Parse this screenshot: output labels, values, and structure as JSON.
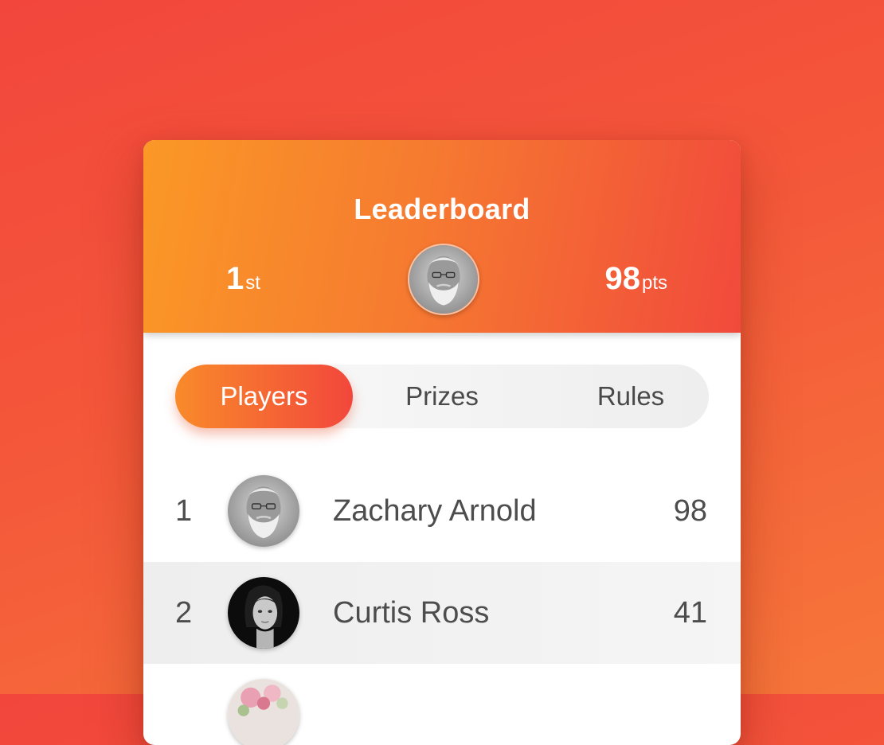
{
  "header": {
    "title": "Leaderboard",
    "rank_number": "1",
    "rank_suffix": "st",
    "points_number": "98",
    "points_suffix": "pts"
  },
  "tabs": [
    {
      "label": "Players",
      "active": true
    },
    {
      "label": "Prizes",
      "active": false
    },
    {
      "label": "Rules",
      "active": false
    }
  ],
  "players": [
    {
      "rank": "1",
      "name": "Zachary Arnold",
      "score": "98",
      "avatar": "elderly-man-avatar"
    },
    {
      "rank": "2",
      "name": "Curtis Ross",
      "score": "41",
      "avatar": "woman-dark-avatar"
    },
    {
      "rank": "",
      "name": "",
      "score": "",
      "avatar": "flower-avatar"
    }
  ],
  "colors": {
    "background_start": "#f2463c",
    "background_end": "#f6763a",
    "header_start": "#fb9826",
    "header_end": "#f14a3c",
    "active_tab_start": "#f98a2a",
    "active_tab_end": "#f2473c",
    "text_dark": "#4d4d4d",
    "text_light": "#ffffff"
  }
}
